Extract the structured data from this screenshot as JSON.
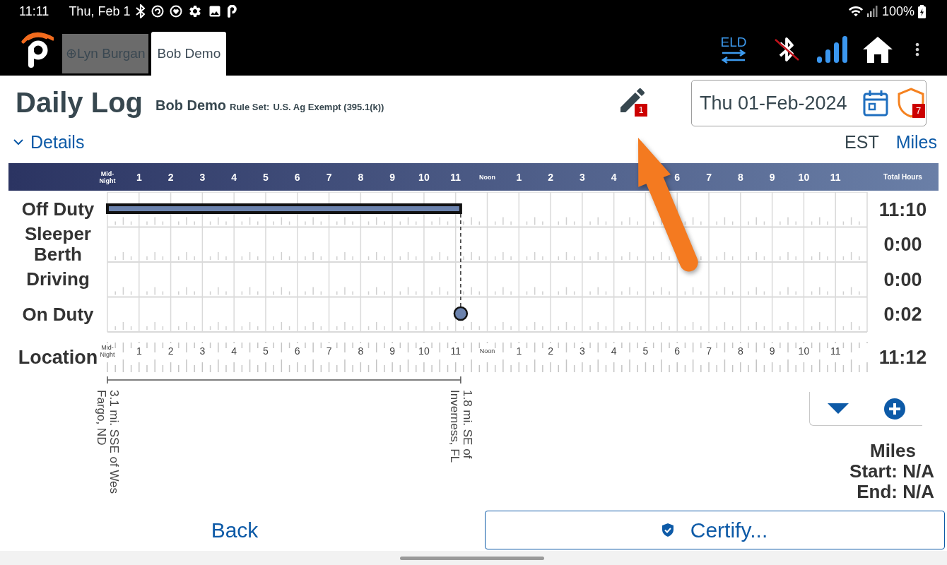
{
  "status_bar": {
    "time": "11:11",
    "date": "Thu, Feb 1",
    "battery": "100%"
  },
  "app_bar": {
    "tabs": [
      {
        "label": "⊕Lyn Burgan",
        "selected": false
      },
      {
        "label": "Bob Demo",
        "selected": true
      }
    ],
    "eld_label": "ELD"
  },
  "header": {
    "title": "Daily Log",
    "driver": "Bob Demo",
    "rule_set_label": "Rule Set:",
    "rule_set": "U.S. Ag Exempt (395.1(k))",
    "edits_badge": "1",
    "date": "Thu 01-Feb-2024",
    "alerts_badge": "7"
  },
  "details_bar": {
    "details": {
      "label": "Details",
      "expanded": false
    },
    "timezone": "EST",
    "units": "Miles"
  },
  "log_graph": {
    "hours": [
      {
        "label": "Mid-Night",
        "covered": false
      },
      {
        "label": "1",
        "covered": false
      },
      {
        "label": "2",
        "covered": false
      },
      {
        "label": "3",
        "covered": false
      },
      {
        "label": "4",
        "covered": false
      },
      {
        "label": "5",
        "covered": false
      },
      {
        "label": "6",
        "covered": false
      },
      {
        "label": "7",
        "covered": false
      },
      {
        "label": "8",
        "covered": false
      },
      {
        "label": "9",
        "covered": false
      },
      {
        "label": "10",
        "covered": false
      },
      {
        "label": "11",
        "covered": false
      },
      {
        "label": "Noon",
        "covered": false
      },
      {
        "label": "1",
        "covered": false
      },
      {
        "label": "2",
        "covered": false
      },
      {
        "label": "3",
        "covered": false
      },
      {
        "label": "4",
        "covered": false
      },
      {
        "covered": true
      },
      {
        "label": "6",
        "covered": false
      },
      {
        "label": "7",
        "covered": false
      },
      {
        "label": "8",
        "covered": false
      },
      {
        "label": "9",
        "covered": false
      },
      {
        "label": "10",
        "covered": false
      },
      {
        "label": "11",
        "covered": false
      }
    ],
    "totals_header": "Total Hours",
    "rows": [
      {
        "label": "Off Duty",
        "total": "11:10",
        "kind": "bar",
        "level": 0.465
      },
      {
        "label": "Sleeper Berth",
        "total": "0:00",
        "kind": "empty"
      },
      {
        "label": "Driving",
        "total": "0:00",
        "kind": "empty"
      },
      {
        "label": "On Duty",
        "total": "0:02",
        "kind": "marker",
        "level": 0.465
      }
    ]
  },
  "location": {
    "title": "Location",
    "ticks": [
      "Mid-Night",
      "1",
      "2",
      "3",
      "4",
      "5",
      "6",
      "7",
      "8",
      "9",
      "10",
      "11",
      "Noon",
      "1",
      "2",
      "3",
      "4",
      "5",
      "6",
      "7",
      "8",
      "9",
      "10",
      "11"
    ],
    "total": "11:12",
    "stops": [
      {
        "lines": [
          "3.1 mi. SSE of Wes",
          "Fargo, ND"
        ]
      },
      {
        "lines": [
          "1.8 mi. SE of",
          "Inverness, FL"
        ]
      }
    ]
  },
  "miles": {
    "title": "Miles",
    "start": "Start: N/A",
    "end": "End: N/A"
  },
  "footer": {
    "back": "Back",
    "certify": "Certify..."
  }
}
